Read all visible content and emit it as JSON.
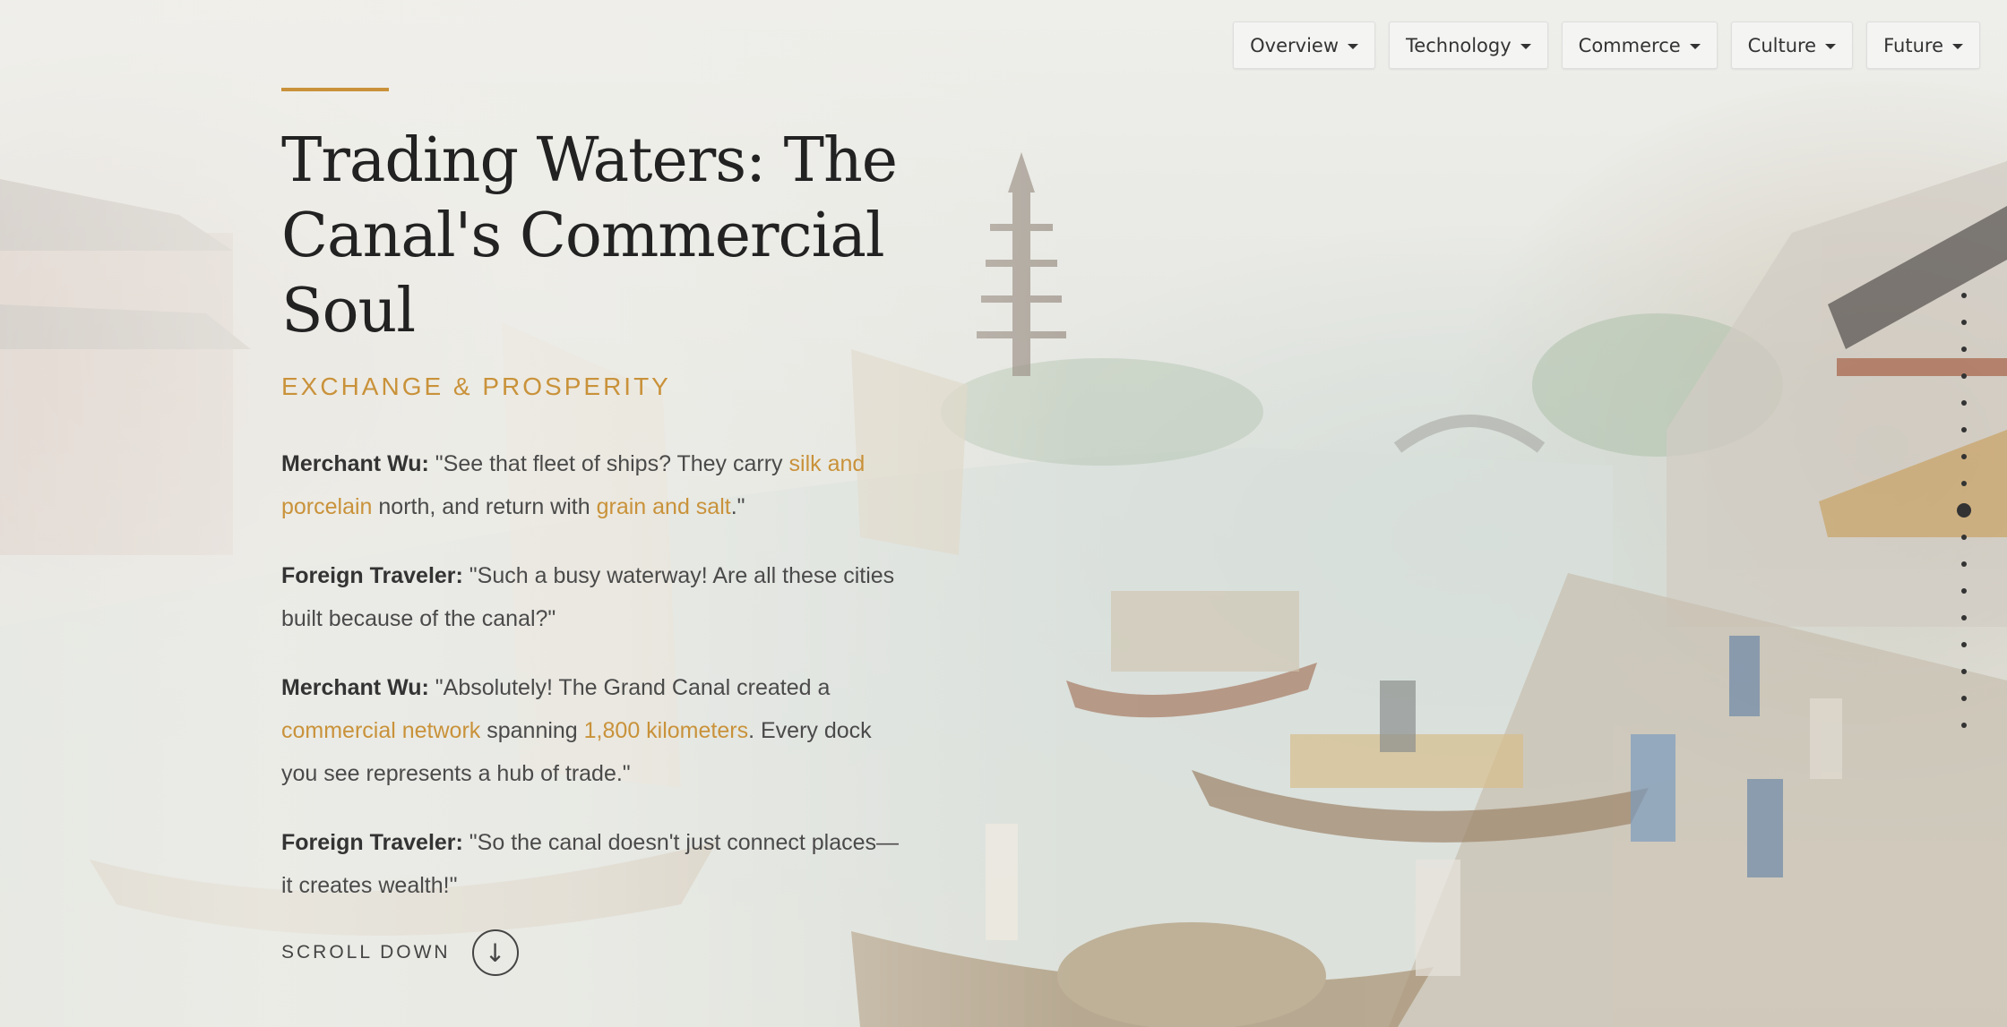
{
  "nav": {
    "items": [
      {
        "label": "Overview"
      },
      {
        "label": "Technology"
      },
      {
        "label": "Commerce"
      },
      {
        "label": "Culture"
      },
      {
        "label": "Future"
      }
    ]
  },
  "hero": {
    "title": "Trading Waters: The Canal's Commercial Soul",
    "subtitle": "EXCHANGE & PROSPERITY"
  },
  "dialogue": [
    {
      "speaker": "Merchant Wu:",
      "parts": [
        {
          "text": " \"See that fleet of ships? They carry ",
          "hl": false
        },
        {
          "text": "silk and porcelain",
          "hl": true
        },
        {
          "text": " north, and return with ",
          "hl": false
        },
        {
          "text": "grain and salt",
          "hl": true
        },
        {
          "text": ".\"",
          "hl": false
        }
      ]
    },
    {
      "speaker": "Foreign Traveler:",
      "parts": [
        {
          "text": " \"Such a busy waterway! Are all these cities built because of the canal?\"",
          "hl": false
        }
      ]
    },
    {
      "speaker": "Merchant Wu:",
      "parts": [
        {
          "text": " \"Absolutely! The Grand Canal created a ",
          "hl": false
        },
        {
          "text": "commercial network",
          "hl": true
        },
        {
          "text": " spanning ",
          "hl": false
        },
        {
          "text": "1,800 kilometers",
          "hl": true
        },
        {
          "text": ". Every dock you see represents a hub of trade.\"",
          "hl": false
        }
      ]
    },
    {
      "speaker": "Foreign Traveler:",
      "parts": [
        {
          "text": " \"So the canal doesn't just connect places—it creates wealth!\"",
          "hl": false
        }
      ]
    }
  ],
  "scroll": {
    "label": "SCROLL DOWN",
    "icon": "arrow-down-icon",
    "glyph": "↓"
  },
  "side_nav": {
    "count": 17,
    "active_index": 8
  },
  "colors": {
    "accent": "#c9923a",
    "text": "#333333"
  }
}
